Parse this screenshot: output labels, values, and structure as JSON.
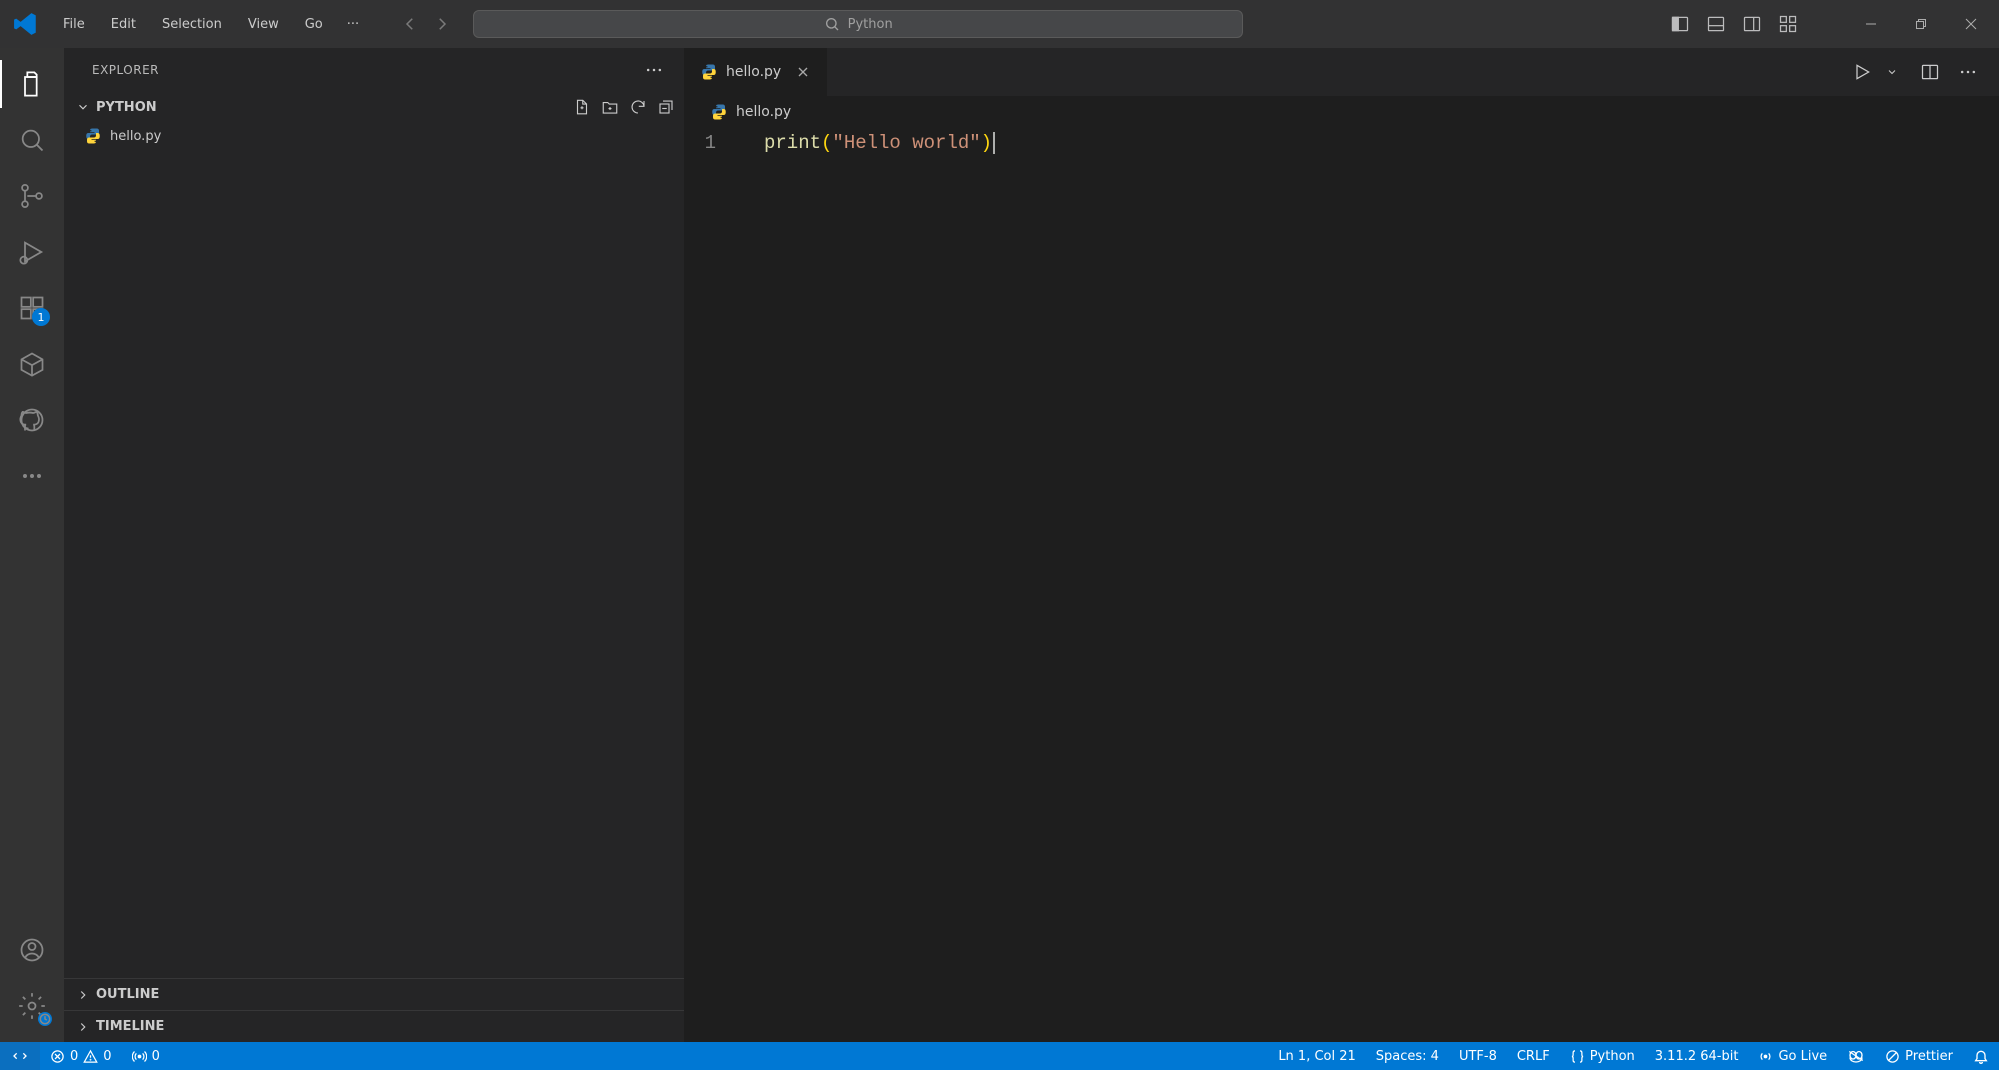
{
  "titlebar": {
    "menus": [
      "File",
      "Edit",
      "Selection",
      "View",
      "Go"
    ],
    "ellipsis": "···",
    "search_text": "Python"
  },
  "activity": {
    "extensions_badge": "1"
  },
  "sidebar": {
    "title": "EXPLORER",
    "project": "PYTHON",
    "files": [
      {
        "name": "hello.py"
      }
    ],
    "outline": "OUTLINE",
    "timeline": "TIMELINE"
  },
  "tabs": [
    {
      "name": "hello.py",
      "active": true
    }
  ],
  "breadcrumb": "hello.py",
  "code": {
    "lines": [
      {
        "n": "1",
        "fn": "print",
        "paren_open": "(",
        "str": "\"Hello world\"",
        "paren_close": ")"
      }
    ]
  },
  "status": {
    "errors": "0",
    "warnings": "0",
    "ports": "0",
    "cursor": "Ln 1, Col 21",
    "spaces": "Spaces: 4",
    "encoding": "UTF-8",
    "eol": "CRLF",
    "lang": "Python",
    "interpreter": "3.11.2 64-bit",
    "golive": "Go Live",
    "prettier": "Prettier"
  }
}
